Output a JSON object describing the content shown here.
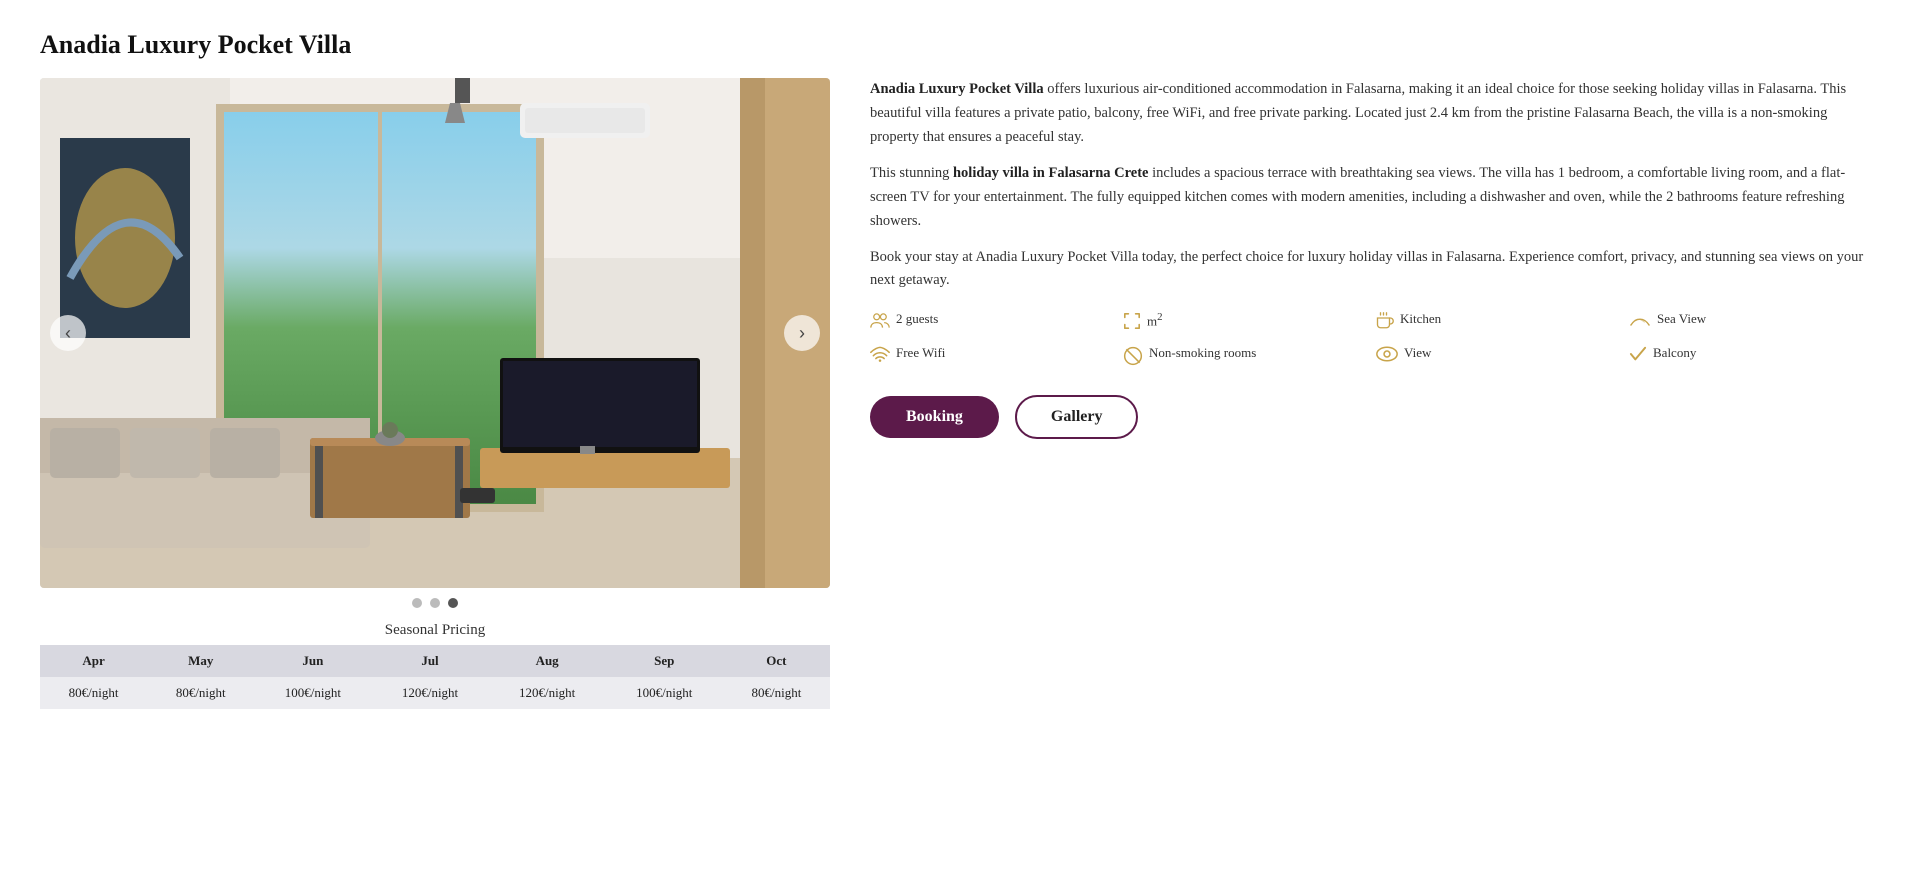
{
  "page": {
    "title": "Anadia Luxury Pocket Villa"
  },
  "slider": {
    "prev_label": "‹",
    "next_label": "›",
    "dots": [
      {
        "active": false
      },
      {
        "active": false
      },
      {
        "active": true
      }
    ]
  },
  "pricing": {
    "section_title": "Seasonal Pricing",
    "columns": [
      "Apr",
      "May",
      "Jun",
      "Jul",
      "Aug",
      "Sep",
      "Oct"
    ],
    "row": [
      "80€/night",
      "80€/night",
      "100€/night",
      "120€/night",
      "120€/night",
      "100€/night",
      "80€/night"
    ]
  },
  "description": {
    "para1_bold": "Anadia Luxury Pocket Villa",
    "para1_rest": " offers luxurious air-conditioned accommodation in Falasarna, making it an ideal choice for those seeking holiday villas in Falasarna. This beautiful villa features a private patio, balcony, free WiFi, and free private parking. Located just 2.4 km from the pristine Falasarna Beach, the villa is a non-smoking property that ensures a peaceful stay.",
    "para2_pre": "This stunning ",
    "para2_bold": "holiday villa in Falasarna Crete",
    "para2_rest": " includes a spacious terrace with breathtaking sea views. The villa has 1 bedroom, a comfortable living room, and a flat-screen TV for your entertainment. The fully equipped kitchen comes with modern amenities, including a dishwasher and oven, while the 2 bathrooms feature refreshing showers.",
    "para3": "Book your stay at Anadia Luxury Pocket Villa today, the perfect choice for luxury holiday villas in Falasarna. Experience comfort, privacy, and stunning sea views on your next getaway."
  },
  "amenities": [
    {
      "icon": "👥",
      "label": "2 guests"
    },
    {
      "icon": "⬜",
      "label": "m²"
    },
    {
      "icon": "☕",
      "label": "Kitchen"
    },
    {
      "icon": "🏖",
      "label": "Sea View"
    },
    {
      "icon": "📶",
      "label": "Free Wifi"
    },
    {
      "icon": "🚭",
      "label": "Non-smoking rooms"
    },
    {
      "icon": "👁",
      "label": "View"
    },
    {
      "icon": "✓",
      "label": "Balcony"
    }
  ],
  "buttons": {
    "booking": "Booking",
    "gallery": "Gallery"
  }
}
